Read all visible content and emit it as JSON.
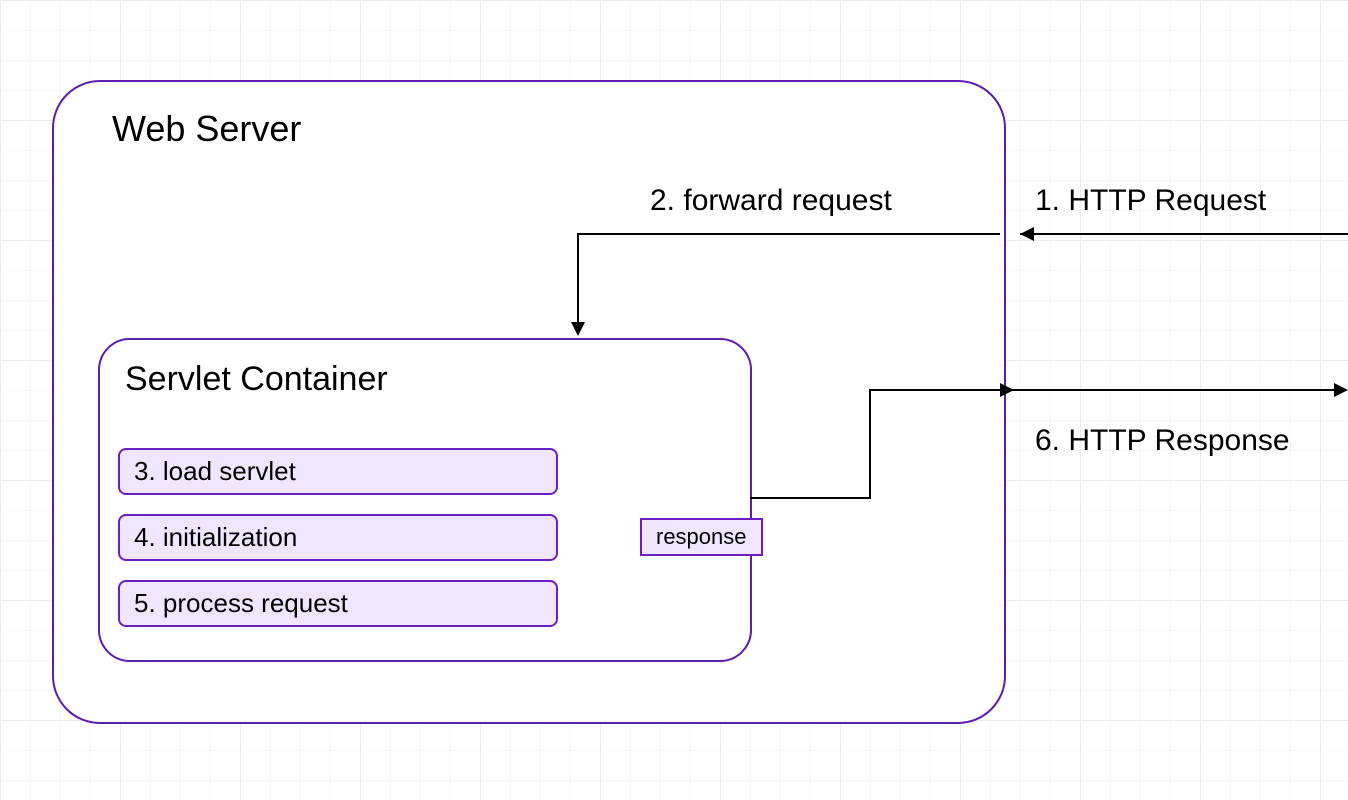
{
  "web_server": {
    "title": "Web Server"
  },
  "servlet_container": {
    "title": "Servlet Container",
    "steps": {
      "s3": "3. load servlet",
      "s4": "4. initialization",
      "s5": "5. process request"
    },
    "response_label": "response"
  },
  "arrows": {
    "step1": "1. HTTP Request",
    "step2": "2. forward request",
    "step6": "6. HTTP Response"
  }
}
